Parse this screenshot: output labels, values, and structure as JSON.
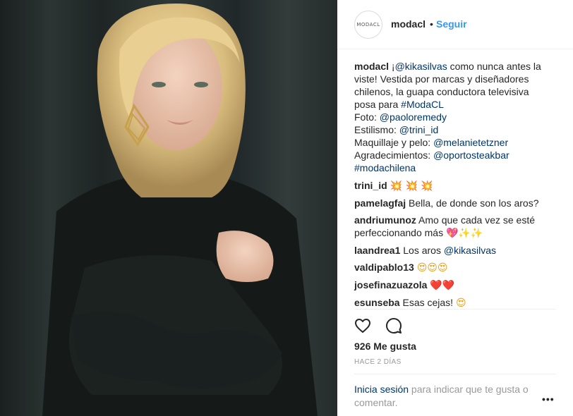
{
  "header": {
    "avatar_text": "MODACL",
    "username": "modacl",
    "separator": "•",
    "follow_label": "Seguir"
  },
  "caption": {
    "username": "modacl",
    "lines": [
      {
        "text": "¡",
        "mention": "@kikasilvas",
        "rest": " como nunca antes la"
      },
      {
        "text": "viste! Vestida por marcas y diseñadores"
      },
      {
        "text": "chilenos, la guapa conductora televisiva"
      },
      {
        "text": "posa para ",
        "tag": "#ModaCL"
      },
      {
        "text": "Foto: ",
        "mention": "@paoloremedy"
      },
      {
        "text": "Estilismo: ",
        "mention": "@trini_id"
      },
      {
        "text": "Maquillaje y pelo: ",
        "mention": "@melanietetzner"
      },
      {
        "text": "Agradecimientos: ",
        "mention": "@oportosteakbar"
      },
      {
        "tag": "#modachilena"
      }
    ]
  },
  "comments": [
    {
      "user": "trini_id",
      "text": "",
      "emoji": "💥 💥 💥"
    },
    {
      "user": "pamelagfaj",
      "text": "Bella, de donde son los aros?"
    },
    {
      "user": "andriumunoz",
      "text": "Amo que cada vez se esté perfeccionando más",
      "emoji": "💖✨✨"
    },
    {
      "user": "laandrea1",
      "text": "Los aros ",
      "mention": "@kikasilvas"
    },
    {
      "user": "valdipablo13",
      "text": "",
      "emoji": "😍😍😍"
    },
    {
      "user": "josefinazuazola",
      "text": "",
      "emoji": "❤️❤️"
    },
    {
      "user": "esunseba",
      "text": "Esas cejas! ",
      "emoji": "😍"
    }
  ],
  "actions": {
    "like_icon": "heart-icon",
    "comment_icon": "comment-icon"
  },
  "likes_label": "926 Me gusta",
  "time_label": "HACE 2 DÍAS",
  "login_prompt": {
    "link": "Inicia sesión",
    "text": " para indicar que te gusta o comentar."
  },
  "more_label": "•••",
  "colors": {
    "accent": "#3897f0",
    "link": "#003569",
    "muted": "#999999"
  }
}
